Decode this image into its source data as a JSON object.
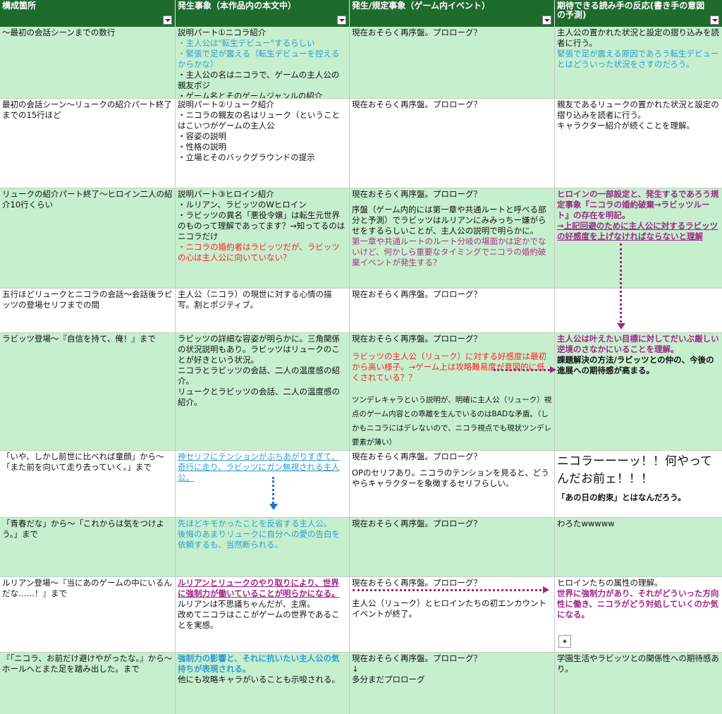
{
  "colors": {
    "header_bg": "#1e6b2e",
    "row_green": "#c6efce",
    "blue": "#2e9bd6",
    "red": "#ff2020",
    "purple": "#a0268a"
  },
  "headers": [
    "構成箇所",
    "発生事象（本作品内の本文中）",
    "発生/規定事象（ゲーム内イベント）",
    "期待できる読み手の反応(書き手の意図の予測)"
  ],
  "rows": [
    {
      "c1": [
        "〜最初の会話シーンまでの数行"
      ],
      "c2": [
        "説明パート①ニコラ紹介",
        "・主人公は\"転生デビュー\"するらしい",
        "・緊張で足が震える（転生デビューを控えるからかな）",
        "・主人公の名はニコラで、ゲームの主人公の親友ポジ",
        "・ゲーム名とそのゲームジャンルの紹介"
      ],
      "c3": [
        "現在おそらく再序盤。プロローグ？"
      ],
      "c4": [
        "主人公の置かれた状況と設定の摺り込みを読者に行う。",
        "緊張で足が震える原因であろう転生デビューとはどういった状況をさすのだろう。"
      ]
    },
    {
      "c1": [
        "最初の会話シーン〜リュークの紹介パート終了までの15行ほど"
      ],
      "c2": [
        "説明パート②リューク紹介",
        "・ニコラの親友の名はリューク（ということはこいつがゲームの主人公",
        "・容姿の説明",
        "・性格の説明",
        "・立場とそのバックグラウンドの提示"
      ],
      "c3": [
        "現在おそらく再序盤。プロローグ？"
      ],
      "c4": [
        "親友であるリュークの置かれた状況と設定の摺り込みを読者に行う。",
        "キャラクター紹介が続くことを理解。"
      ]
    },
    {
      "c1": [
        "リュークの紹介パート終了〜ヒロイン二人の紹介10行くらい"
      ],
      "c2": [
        "説明パート③ヒロイン紹介",
        "・ルリアン、ラビッツのWヒロイン",
        "・ラビッツの異名「悪役令嬢」は転生元世界のものって理解であってます？→知ってるのはニコラだけ",
        "・ニコラの婚約者はラビッツだが、ラビッツの心は主人公に向いていない？"
      ],
      "c3": [
        "現在おそらく再序盤。プロローグ？",
        "序盤（ゲーム内的には第一章や共通ルートと呼べる部分と予測）でラビッツはルリアンにみみっちー嫌がらせをするらしいことが、主人公の説明で明らかに。",
        "第一章や共通ルートのルート分岐の場面かは定かでないけど、何かしら重要なタイミングでニコラの婚約破棄イベントが発生する？"
      ],
      "c4": [
        "ヒロインの一部設定と、発生するであろう規定事象『ニコラの婚約破棄→ラビッツルート』の存在を明記。",
        "→上記回避のために主人公に対するラビッツの好感度を上げなければならないと理解"
      ]
    },
    {
      "c1": [
        "五行ほどリュークとニコラの会話〜会話後ラビッツの登場セリフまでの間"
      ],
      "c2": [
        "主人公（ニコラ）の現世に対する心情の描写。割とポジティブ。"
      ],
      "c3": [
        "現在おそらく再序盤。プロローグ？"
      ],
      "c4": []
    },
    {
      "c1": [
        "ラビッツ登場〜『自信を持て、俺！』まで"
      ],
      "c2": [
        "ラビッツの詳細な容姿が明らかに。三角関係の状況説明もあり。ラビッツはリュークのことが好きという状況。",
        "ニコラとラビッツの会話、二人の温度感の紹介。",
        "リュークとラビッツの会話、二人の温度感の紹介。"
      ],
      "c3": [
        "現在おそらく再序盤。プロローグ？",
        "ラビッツの主人公（リューク）に対する好感度は最初から高い様子。→ゲーム上は攻略難易度が意図的に低くされている？？",
        "ツンデレキャラという説明が、明確に主人公（リューク）視点のゲーム内容との乖離を生んでいるのはBADな矛盾。（しかもニコラにはデレないので、ニコラ視点でも現状ツンデレ要素が薄い）"
      ],
      "c4": [
        "主人公は叶えたい目標に対してだいぶ厳しい逆境のさなかにいることを理解。",
        "課題解決の方法/ラビッツとの仲の、今後の進展への期待感が高まる。"
      ]
    },
    {
      "c1": [
        "「いや、しかし前世に比べれば童顔」から〜「また前を向いて走り去っていく。」まで"
      ],
      "c2": [
        "神セリフにテンションがぶちあがりすぎて、奇行に走り、ラビッツにガン無視される主人公。"
      ],
      "c3": [
        "現在おそらく再序盤。プロローグ？",
        "OPのセリフあり。ニコラのテンションを見ると、どうやらキャラクターを象徴するセリフらしい。"
      ],
      "c4": [
        "ニコラーーーッ！！何やってんだお前ェ！！！",
        "「あの日の約束」とはなんだろう。"
      ]
    },
    {
      "c1": [
        "「青春だな」から〜「これからは気をつけよう。」まで"
      ],
      "c2": [
        "先ほどキモかったことを反省する主人公。",
        "後悔のあまりリュークに自分への愛の告白を依頼するも、当然断られる。"
      ],
      "c3": [
        "現在おそらく再序盤。プロローグ？"
      ],
      "c4": [
        "わろたwwwww"
      ]
    },
    {
      "c1": [
        "ルリアン登場〜『当にあのゲームの中にいるんだな……！』まで"
      ],
      "c2": [
        "ルリアンとリュークのやり取りにより、世界に強制力が働いていることが明らかになる。",
        "ルリアンは不思議ちゃんだが、主席。",
        "改めてニコラはここがゲームの世界であることを実感。"
      ],
      "c3": [
        "現在おそらく再序盤。プロローグ？",
        "主人公（リューク）とヒロインたちの初エンカウントイベントが終了。"
      ],
      "c4": [
        "ヒロインたちの属性の理解。",
        "世界に強制力があり、それがどういった方向性に働き、ニコラがどう対処していくのか気になる。"
      ]
    },
    {
      "c1": [
        "『「ニコラ、お前だけ避けやがったな。』から〜ホールへとまた足を踏み出した。まで"
      ],
      "c2": [
        "強制力の影響と、それに抗いたい主人公の気持ちが表現される。",
        "他にも攻略キャラがいることも示唆される。"
      ],
      "c3": [
        "現在おそらく再序盤。プロローグ？",
        "↓",
        "多分まだプロローグ"
      ],
      "c4": [
        "学園生活やラビッツとの関係性への期待感あり。"
      ]
    }
  ]
}
